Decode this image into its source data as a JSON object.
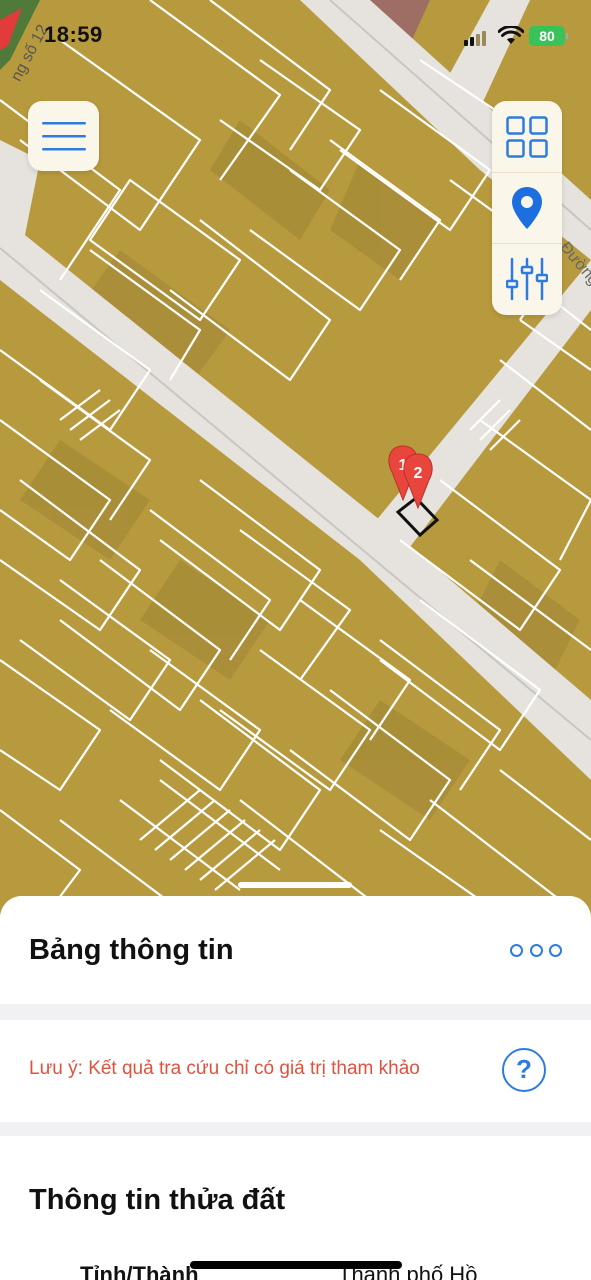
{
  "status_bar": {
    "time": "18:59",
    "battery": "80"
  },
  "map": {
    "street_labels": [
      "ng số 12",
      "Đường"
    ],
    "markers": [
      {
        "label": "1",
        "color": "#e8453c"
      },
      {
        "label": "2",
        "color": "#e8453c"
      }
    ],
    "colors": {
      "land": "#b89a3e",
      "parcel_line": "#ffffff",
      "road": "#e5e3df",
      "highlight_parcel": "#111111"
    }
  },
  "controls": {
    "menu_icon": "hamburger-icon",
    "layers_icon": "grid-icon",
    "location_icon": "location-pin-icon",
    "filter_icon": "sliders-icon",
    "accent": "#2c7be0"
  },
  "sheet": {
    "title": "Bảng thông tin",
    "more_icon": "more-dots-icon",
    "note": "Lưu ý: Kết quả tra cứu chỉ có giá trị tham khảo",
    "help_label": "?",
    "parcel_title": "Thông tin thửa đất",
    "rows": [
      {
        "label": "Tỉnh/Thành",
        "value": "Thành phố Hồ"
      }
    ]
  }
}
